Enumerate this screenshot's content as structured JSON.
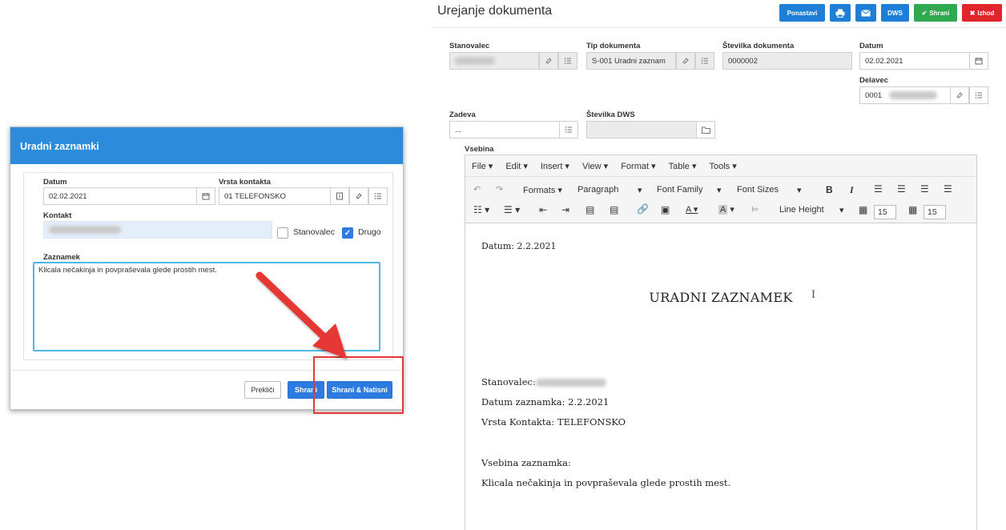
{
  "modal": {
    "title": "Uradni zaznamki",
    "datum_label": "Datum",
    "datum_value": "02.02.2021",
    "vrsta_label": "Vrsta kontakta",
    "vrsta_value": "01 TELEFONSKO",
    "kontakt_label": "Kontakt",
    "stanovalec_label": "Stanovalec",
    "drugo_label": "Drugo",
    "drugo_checked": true,
    "zaznamek_label": "Zaznamek",
    "zaznamek_value": "Klicala nečakinja in povpraševala glede prostih mest.",
    "cancel_label": "Prekliči",
    "save_label": "Shrani",
    "save_print_label": "Shrani & Natisni"
  },
  "page": {
    "title": "Urejanje dokumenta",
    "buttons": {
      "reset": "Ponastavi",
      "dws": "DWS",
      "save": "Shrani",
      "exit": "Izhod"
    }
  },
  "form": {
    "stanovalec_label": "Stanovalec",
    "tip_label": "Tip dokumenta",
    "tip_value": "S-001 Uradni zaznam",
    "stevilka_label": "Številka dokumenta",
    "stevilka_value": "0000002",
    "datum_label": "Datum",
    "datum_value": "02.02.2021",
    "delavec_label": "Delavec",
    "delavec_prefix": "0001",
    "zadeva_label": "Zadeva",
    "zadeva_value": "...",
    "dws_label": "Številka DWS",
    "vsebina_label": "Vsebina"
  },
  "editor": {
    "menu": [
      "File ▾",
      "Edit ▾",
      "Insert ▾",
      "View ▾",
      "Format ▾",
      "Table ▾",
      "Tools ▾"
    ],
    "formats": "Formats ▾",
    "paragraph": "Paragraph",
    "font_family": "Font Family",
    "font_sizes": "Font Sizes",
    "line_height": "Line Height",
    "size_a": "15",
    "size_b": "15",
    "doc": {
      "datum": "Datum: 2.2.2021",
      "heading": "URADNI ZAZNAMEK",
      "stanovalec": "Stanovalec:",
      "datum_zaznamka": "Datum zaznamka: 2.2.2021",
      "vrsta": "Vrsta Kontakta: TELEFONSKO",
      "vsebina_label": "Vsebina zaznamka:",
      "vsebina": "Klicala nečakinja in povpraševala glede prostih mest."
    }
  },
  "colors": {
    "modal_header": "#2d8bdc",
    "primary": "#2d7be0",
    "highlight": "#e53935",
    "save_green": "#2fa84f",
    "exit_red": "#e0262c"
  }
}
